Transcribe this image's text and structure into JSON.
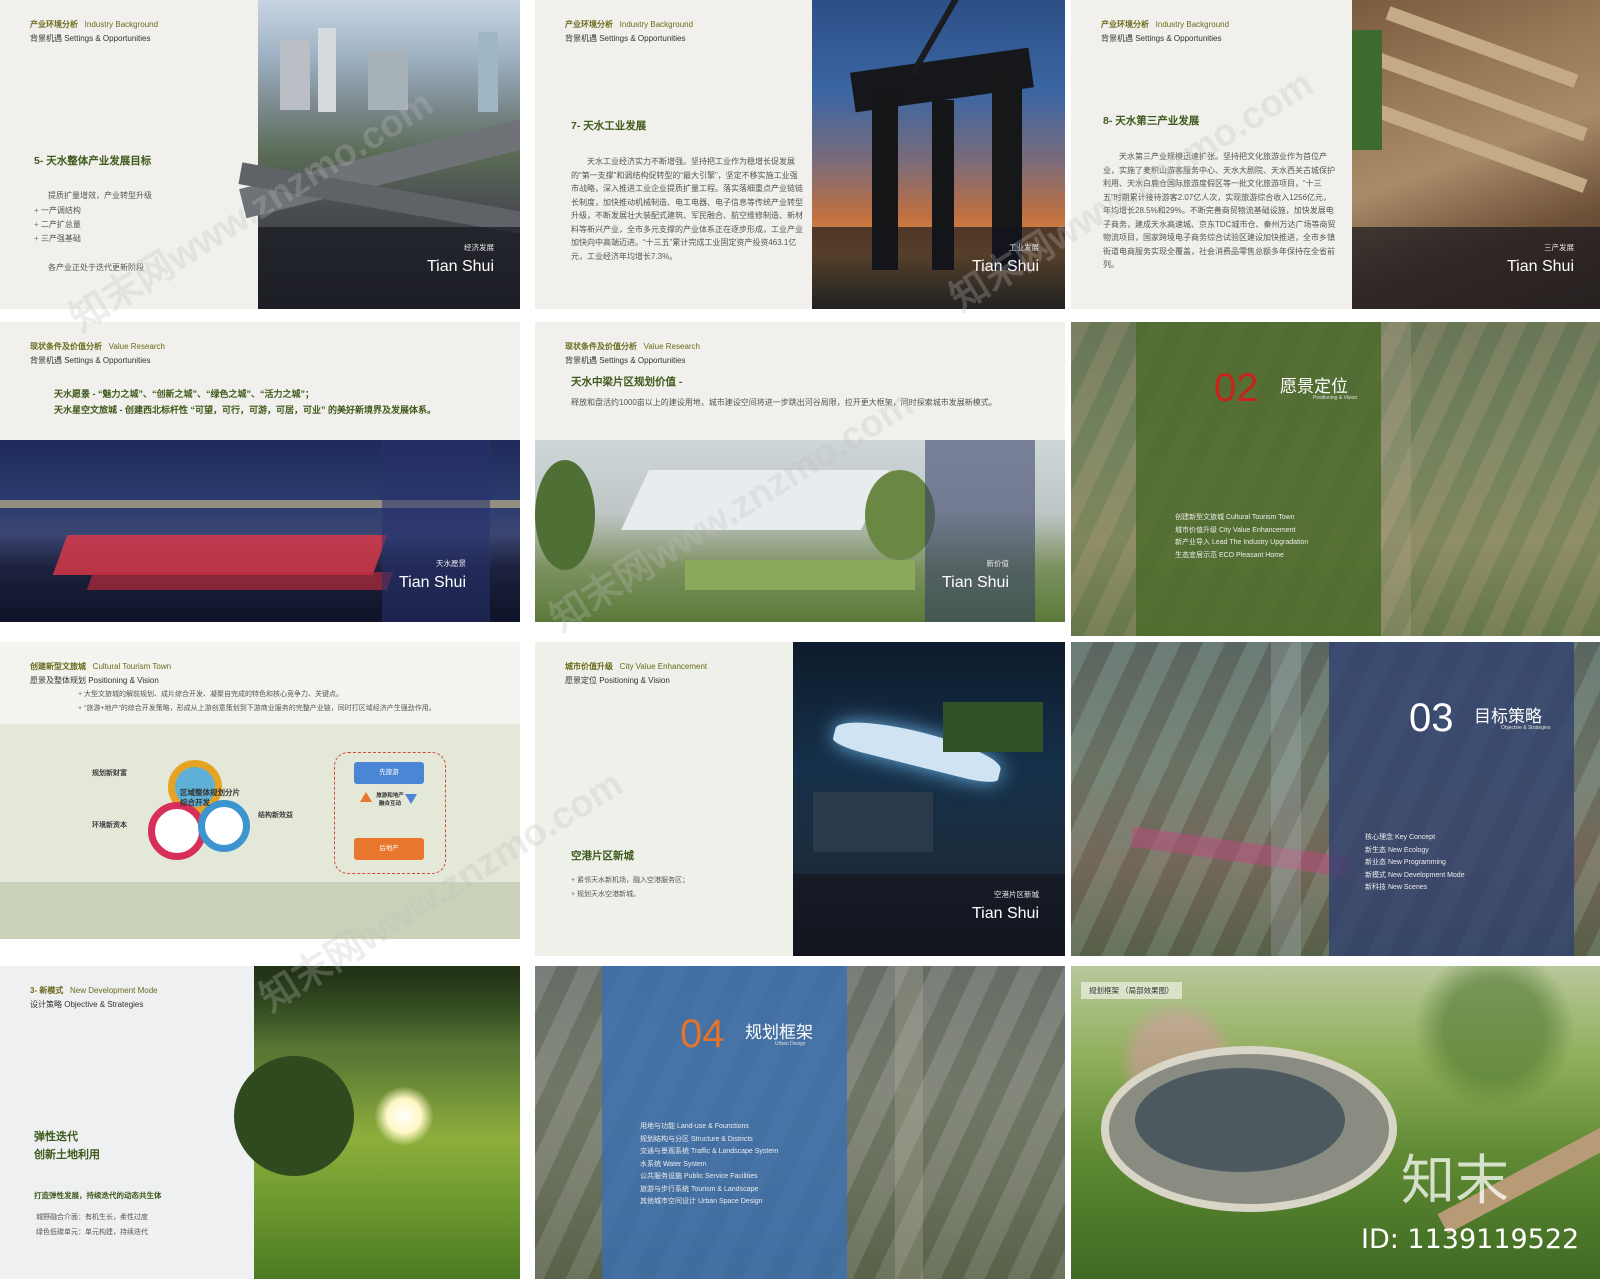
{
  "slides": {
    "s1": {
      "hdr1": "产业环境分析",
      "hdr1_en": "Industry Background",
      "hdr2": "背景机遇   Settings  &  Opportunities",
      "title": "5-   天水整体产业发展目标",
      "lead": "提质扩量增效，产业转型升级",
      "bullets": [
        "一产调结构",
        "二产扩总量",
        "三产强基础"
      ],
      "foot": "各产业正处于迭代更新阶段",
      "tag_small": "经济发展",
      "tag_large": "Tian Shui"
    },
    "s2": {
      "hdr1": "产业环境分析",
      "hdr1_en": "Industry Background",
      "hdr2": "背景机遇   Settings  &  Opportunities",
      "title": "7-    天水工业发展",
      "body": "天水工业经济实力不断增强。坚持把工业作为稳增长促发展的“第一支撑”和调结构促转型的“最大引擎”，坚定不移实施工业强市战略，深入推进工业企业提质扩量工程。落实落细重点产业链链长制度，加快推动机械制造、电工电器、电子信息等传统产业转型升级，不断发展壮大装配式建筑、军民融合、航空维修制造、新材料等新兴产业，全市多元支撑的产业体系正在逐步形成，工业产业加快向中高端迈进。“十三五”累计完成工业固定资产投资463.1亿元，工业经济年均增长7.3%。",
      "tag_small": "工业发展",
      "tag_large": "Tian Shui"
    },
    "s3": {
      "hdr1": "产业环境分析",
      "hdr1_en": "Industry Background",
      "hdr2": "背景机遇   Settings  &  Opportunities",
      "title": "8-    天水第三产业发展",
      "body": "天水第三产业规模迅速扩张。坚持把文化旅游业作为首位产业，实施了麦积山游客服务中心、天水大剧院、天水西关古城保护利用、天水白鹿仓国际旅游度假区等一批文化旅游项目，“十三五”时期累计接待游客2.07亿人次，实现旅游综合收入1256亿元，年均增长28.5%和29%。不断完善商贸物流基础设施，加快发展电子商务，建成天水高速城、京东TDC城市仓、秦州万达广场等商贸物流项目，国家跨境电子商务综合试验区建设加快推进，全市乡镇街道电商服务实现全覆盖，社会消费品零售总额多年保持在全省前列。",
      "tag_small": "三产发展",
      "tag_large": "Tian Shui"
    },
    "s4": {
      "hdr1": "现状条件及价值分析",
      "hdr1_en": "Value Research",
      "hdr2": "背景机遇   Settings  &  Opportunities",
      "line1": "天水愿景     -      “魅力之城”、“创新之城”、“绿色之城”、“活力之城”；",
      "line2": "天水星空文旅城     -      创建西北标杆性 “可望，可行，可游，可居，可业” 的美好新境界及发展体系。",
      "tag_small": "天水愿景",
      "tag_large": "Tian Shui"
    },
    "s5": {
      "hdr1": "现状条件及价值分析",
      "hdr1_en": "Value Research",
      "hdr2": "背景机遇   Settings  &  Opportunities",
      "title": "天水中梁片区规划价值     -",
      "body": "释放和盘活约1000亩以上的建设用地，城市建设空间将进一步跳出河谷局限，拉开更大框架，同时探索城市发展新模式。",
      "tag_small": "新价值",
      "tag_large": "Tian Shui"
    },
    "s6": {
      "num": "02",
      "title": "愿景定位",
      "sub": "Positioning & Vision",
      "items": [
        "创建新型文旅城        Cultural  Tourism  Town",
        "城市价值升级       City  Value  Enhancement",
        "新产业导入       Lead  The  Industry  Upgradation",
        "生态宜居示范       ECO  Pleasant  Home"
      ]
    },
    "s7": {
      "hdr1": "创建新型文旅城",
      "hdr1_en": "Cultural  Tourism  Town",
      "hdr2": "愿景及整体规划   Positioning & Vision",
      "bullets": [
        "大型文旅城的解前规划、成片综合开发、凝聚自完成的特色和核心竞争力、关键点。",
        "“旅游+地产”的综合开发策略，形成从上游创意策划到下游商业服务的完整产业链，同时打区域经济产生强劲作用。"
      ],
      "lbl_a": "规划新财富",
      "lbl_b": "环境新资本",
      "lbl_c": "结构新效益",
      "center": "区域整体规划分片综合开发",
      "box_top": "先旅游",
      "box_mid": "旅游和地产融合互动",
      "box_bottom": "后地产"
    },
    "s8": {
      "hdr1": "城市价值升级",
      "hdr1_en": "City  Value  Enhancement",
      "hdr2": "愿景定位   Positioning & Vision",
      "title": "空港片区新城",
      "bullets": [
        "紧邻天水新机场，融入空港服务区；",
        "规划天水空港新城。"
      ],
      "tag_small": "空港片区新城",
      "tag_large": "Tian Shui"
    },
    "s9": {
      "num": "03",
      "title": "目标策略",
      "sub": "Objective & Strategies",
      "items": [
        "核心理念       Key  Concept",
        "新生态       New  Ecology",
        "新业态       New  Programming",
        "新模式       New  Development  Mode",
        "新科技       New  Scenes"
      ]
    },
    "s10": {
      "hdr1": "3-   新模式",
      "hdr1_en": "New  Development  Mode",
      "hdr2": "设计策略   Objective & Strategies",
      "title1": "弹性迭代",
      "title2": "创新土地利用",
      "sub": "打造弹性发展，持续迭代的动态共生体",
      "l1": "城野融合介面：有机生长，柔性过度",
      "l2": "绿色低碳单元：单元构建，持续迭代"
    },
    "s11": {
      "num": "04",
      "title": "规划框架",
      "sub": "Urban Design",
      "items": [
        "用地与功能    Land-use  &  Founctions",
        "规划结构与分区    Structure  &  Districts",
        "交通与景观系统    Traffic  &  Landscape System",
        "水系统    Water System",
        "公共服务设施    Public  Service  Facilities",
        "旅游与步行系统    Tourism  &  Landscape",
        "其他城市空间设计  Urban Space Design"
      ]
    },
    "s12": {
      "label": "规划框架   （局部效果图）",
      "logo": "知末",
      "id": "ID: 1139119522"
    }
  },
  "watermarks": [
    "知末网www.znzmo.com",
    "知末网www.znzmo.com",
    "知末网www.znzmo.com",
    "知末网www.znzmo.com"
  ],
  "colors": {
    "olive_title": "#3f5a1c",
    "red_num": "#c8231b",
    "orange_num": "#e6732a",
    "green_panel": "#4c6a2b",
    "navy_panel": "#2e3f6e",
    "blue_panel": "#3b6fb1"
  }
}
